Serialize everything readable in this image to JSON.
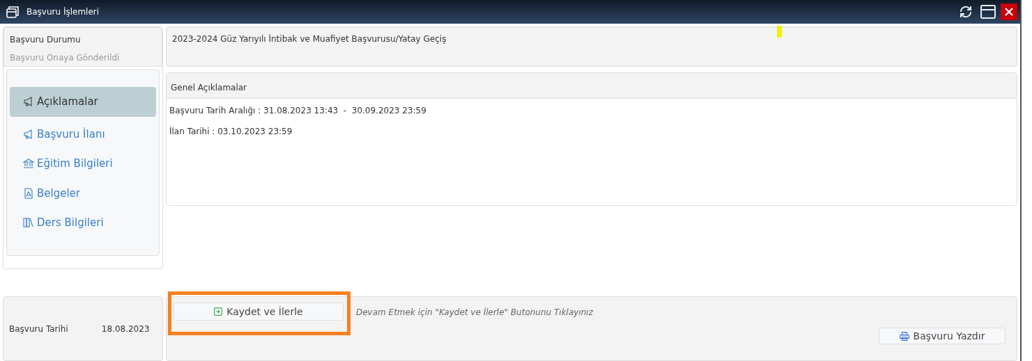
{
  "window": {
    "title": "Başvuru İşlemleri"
  },
  "status": {
    "label": "Başvuru Durumu",
    "value": "Başvuru Onaya Gönderildi"
  },
  "menu": [
    {
      "label": "Açıklamalar",
      "selected": true
    },
    {
      "label": "Başvuru İlanı",
      "selected": false
    },
    {
      "label": "Eğitim Bilgileri",
      "selected": false
    },
    {
      "label": "Belgeler",
      "selected": false
    },
    {
      "label": "Ders Bilgileri",
      "selected": false
    }
  ],
  "application_title": "2023-2024 Güz Yarıyılı İntibak ve Muafiyet Başvurusu/Yatay Geçiş",
  "general": {
    "header": "Genel Açıklamalar",
    "lines": [
      "Başvuru Tarih Aralığı : 31.08.2023 13:43  -  30.09.2023 23:59",
      "İlan Tarihi : 03.10.2023 23:59"
    ]
  },
  "date": {
    "label": "Başvuru Tarihi",
    "value": "18.08.2023"
  },
  "actions": {
    "save_button": "Kaydet ve İlerle",
    "hint": "Devam Etmek için \"Kaydet ve İlerle\" Butonunu Tıklayınız",
    "print_button": "Başvuru Yazdır"
  }
}
